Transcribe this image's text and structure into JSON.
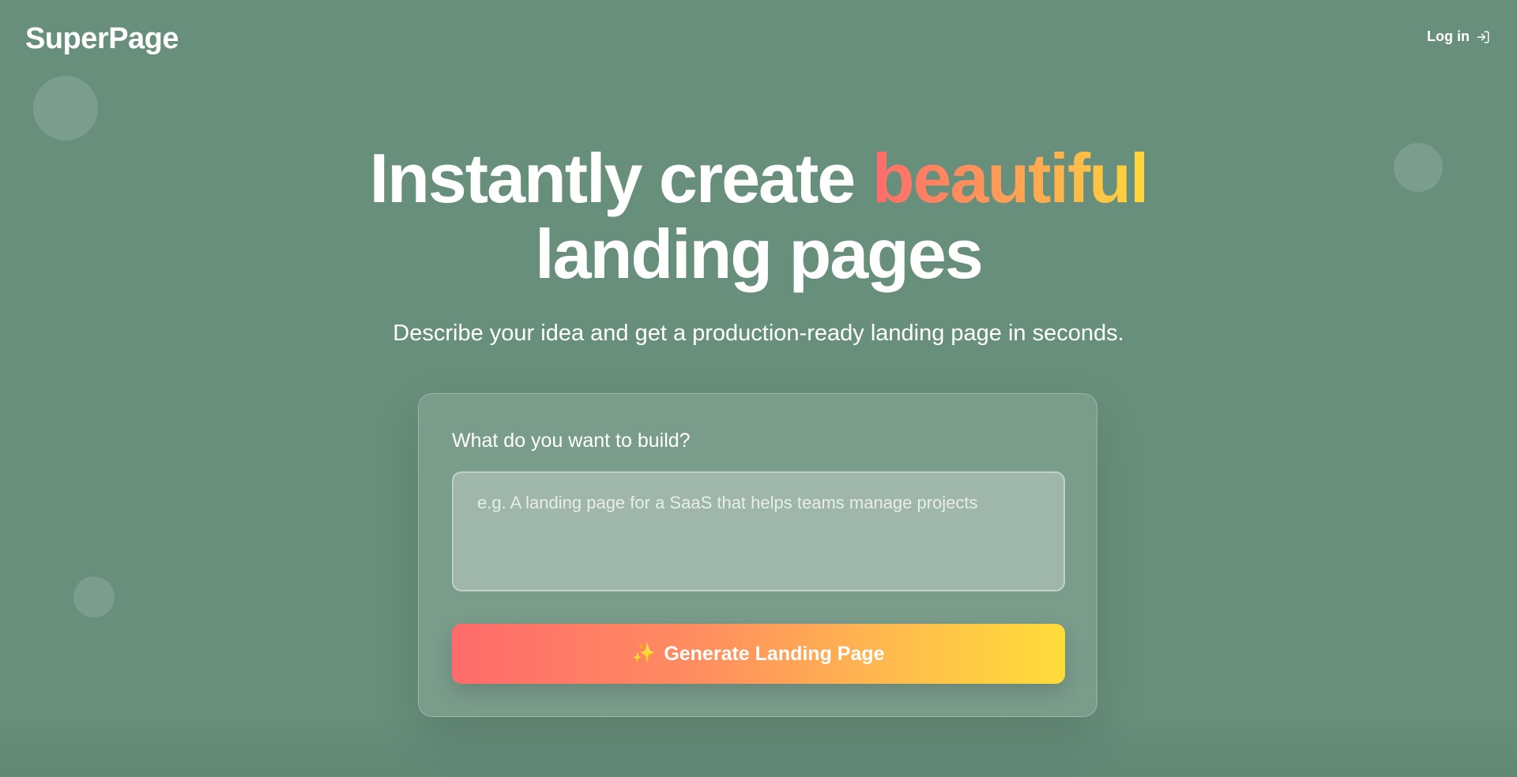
{
  "header": {
    "logo": "SuperPage",
    "login_label": "Log in",
    "login_icon": "log-in-icon"
  },
  "hero": {
    "headline_part1": "Instantly create ",
    "headline_accent": "beautiful",
    "headline_part2": "landing pages",
    "subtitle": "Describe your idea and get a production-ready landing page in seconds."
  },
  "form": {
    "label": "What do you want to build?",
    "prompt_value": "",
    "prompt_placeholder": "e.g. A landing page for a SaaS that helps teams manage projects",
    "generate_icon": "✨",
    "generate_label": "Generate Landing Page"
  },
  "colors": {
    "background": "#688f7c",
    "accent_start": "#ff6b6b",
    "accent_end": "#ffd83c",
    "text": "#ffffff"
  }
}
